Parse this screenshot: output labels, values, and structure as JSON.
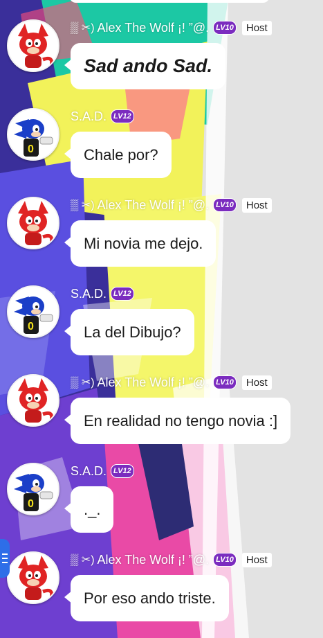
{
  "chat": {
    "messages": [
      {
        "author": "Alex The Wolf ¡! ”@.",
        "name_prefix": "▒ ✂︎)",
        "level": "LV10",
        "host": "Host",
        "text": "Sad ando Sad.",
        "style": "bold",
        "avatar": "wolf-avatar"
      },
      {
        "author": "S.A.D.",
        "name_prefix": "",
        "level": "LV12",
        "host": "",
        "text": "Chale por?",
        "style": "normal",
        "avatar": "sonic-avatar"
      },
      {
        "author": "Alex The Wolf ¡! ”@.",
        "name_prefix": "▒ ✂︎)",
        "level": "LV10",
        "host": "Host",
        "text": "Mi novia me dejo.",
        "style": "normal",
        "avatar": "wolf-avatar"
      },
      {
        "author": "S.A.D.",
        "name_prefix": "",
        "level": "LV12",
        "host": "",
        "text": "La del Dibujo?",
        "style": "normal",
        "avatar": "sonic-avatar"
      },
      {
        "author": "Alex The Wolf ¡! ”@.",
        "name_prefix": "▒ ✂︎)",
        "level": "LV10",
        "host": "Host",
        "text": "En realidad no tengo novia :]",
        "style": "normal",
        "avatar": "wolf-avatar"
      },
      {
        "author": "S.A.D.",
        "name_prefix": "",
        "level": "LV12",
        "host": "",
        "text": "._.",
        "style": "normal",
        "avatar": "sonic-avatar"
      },
      {
        "author": "Alex The Wolf ¡! ”@.",
        "name_prefix": "▒ ✂︎)",
        "level": "LV10",
        "host": "Host",
        "text": "Por eso ando triste.",
        "style": "normal",
        "avatar": "wolf-avatar"
      }
    ]
  },
  "colors": {
    "level_badge": "#7b2cbf",
    "side_handle": "#2e6ee8",
    "bubble": "#ffffff"
  },
  "icons": {
    "side_handle": "menu-icon"
  }
}
